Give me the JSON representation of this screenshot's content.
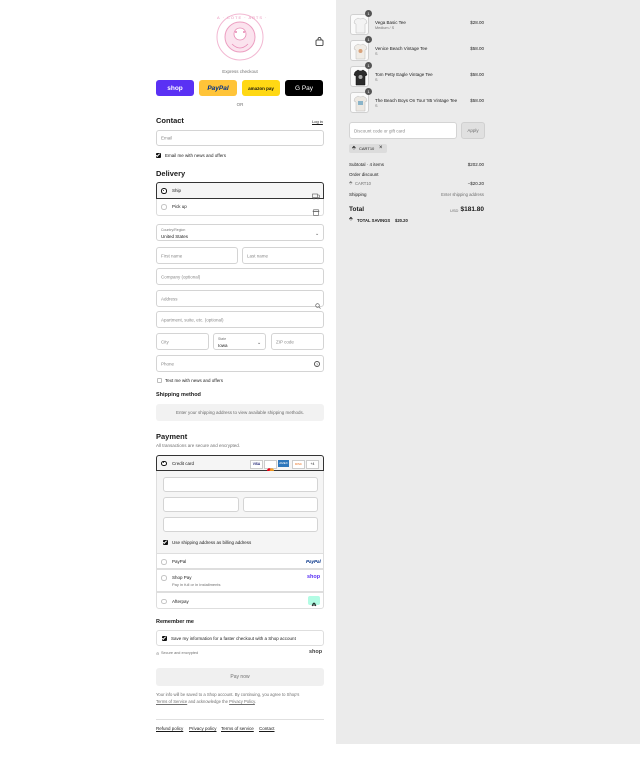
{
  "brand": {
    "logo_text": "A · COTE · ARTS ·"
  },
  "header": {
    "bag_icon": "shopping-bag-icon"
  },
  "express": {
    "label": "Express checkout",
    "or_label": "OR",
    "buttons": [
      {
        "label": "shop",
        "bg": "#5a31f4",
        "fg": "#ffffff"
      },
      {
        "label": "PayPal",
        "bg": "#ffc439",
        "fg": "#003087"
      },
      {
        "label": "amazon pay",
        "bg": "#ffd814",
        "fg": "#111111"
      },
      {
        "label": "G Pay",
        "bg": "#000000",
        "fg": "#ffffff"
      }
    ]
  },
  "contact": {
    "title": "Contact",
    "login_link": "Log in",
    "email_placeholder": "Email",
    "news_label": "Email me with news and offers"
  },
  "delivery": {
    "title": "Delivery",
    "options": [
      {
        "label": "Ship",
        "icon": "truck-icon",
        "selected": true
      },
      {
        "label": "Pick up",
        "icon": "store-icon",
        "selected": false
      }
    ],
    "country_label": "Country/Region",
    "country_value": "United States",
    "first_name": "First name",
    "last_name": "Last name",
    "company": "Company (optional)",
    "address": "Address",
    "apartment": "Apartment, suite, etc. (optional)",
    "city": "City",
    "state_label": "State",
    "state_value": "Iowa",
    "zip": "ZIP code",
    "phone": "Phone",
    "text_label": "Text me with news and offers"
  },
  "shipping_method": {
    "title": "Shipping method",
    "message": "Enter your shipping address to view available shipping methods."
  },
  "payment": {
    "title": "Payment",
    "subtitle": "All transactions are secure and encrypted.",
    "credit_card_label": "Credit card",
    "card_brands": [
      "VISA",
      "MC",
      "AMEX",
      "DISC",
      "+4"
    ],
    "billing_label": "Use shipping address as billing address",
    "options": [
      {
        "label": "PayPal",
        "logo": "PayPal",
        "sub": ""
      },
      {
        "label": "Shop Pay",
        "logo": "shop",
        "sub": "Pay in full or in installments"
      },
      {
        "label": "Afterpay",
        "logo": "afterpay-icon",
        "sub": ""
      }
    ]
  },
  "remember": {
    "title": "Remember me",
    "save_label": "Save my information for a faster checkout with a Shop account",
    "secure_label": "Secure and encrypted",
    "shop_logo": "shop"
  },
  "pay_now": "Pay now",
  "legal": {
    "text_1": "Your info will be saved to a Shop account. By continuing, you agree to Shop's",
    "tos": "Terms of Service",
    "and": "and acknowledge the",
    "privacy": "Privacy Policy",
    "period": "."
  },
  "footer": {
    "links": [
      "Refund policy",
      "Privacy policy",
      "Terms of service",
      "Contact"
    ]
  },
  "summary": {
    "items": [
      {
        "qty": "1",
        "name": "Vega Basic Tee",
        "variant": "Medium / S",
        "price": "$28.00",
        "shirt": "#f3f3f3"
      },
      {
        "qty": "1",
        "name": "Venice Beach Vintage Tee",
        "variant": "S",
        "price": "$58.00",
        "shirt": "#f0ece6"
      },
      {
        "qty": "1",
        "name": "Tom Petty Eagle Vintage Tee",
        "variant": "S",
        "price": "$58.00",
        "shirt": "#2b2b2b"
      },
      {
        "qty": "1",
        "name": "The Beach Boys On Tour '85 Vintage Tee",
        "variant": "S",
        "price": "$58.00",
        "shirt": "#ece8e2"
      }
    ],
    "discount_placeholder": "Discount code or gift card",
    "apply_label": "Apply",
    "applied_code": "CART10",
    "subtotal_label": "Subtotal · 4 items",
    "subtotal_value": "$202.00",
    "order_discount_label": "Order discount",
    "order_discount_code": "CART10",
    "order_discount_value": "−$20.20",
    "shipping_label": "Shipping",
    "shipping_value": "Enter shipping address",
    "total_label": "Total",
    "currency": "USD",
    "total_value": "$181.80",
    "savings_label": "TOTAL SAVINGS",
    "savings_value": "$20.20"
  }
}
